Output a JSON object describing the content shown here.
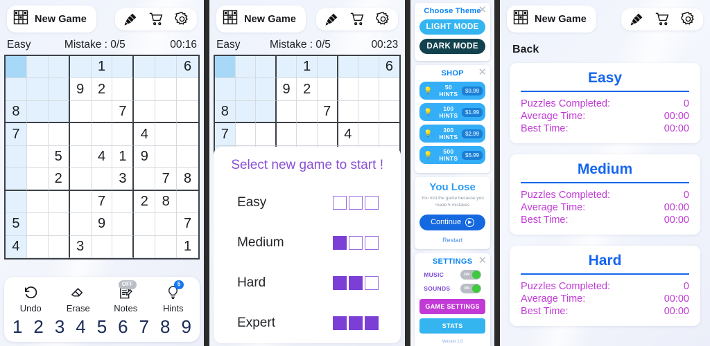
{
  "app": {
    "new_game_label": "New Game",
    "icons": {
      "grid": "grid-icon",
      "brush": "brush-icon",
      "cart": "cart-icon",
      "gear": "gear-icon"
    }
  },
  "panel1": {
    "status": {
      "difficulty": "Easy",
      "mistake": "Mistake : 0/5",
      "timer": "00:16"
    },
    "board": {
      "selected": [
        0,
        0
      ],
      "rows": [
        [
          "",
          "",
          "",
          "",
          "1",
          "",
          "",
          "",
          "6"
        ],
        [
          "",
          "",
          "",
          "9",
          "2",
          "",
          "",
          "",
          ""
        ],
        [
          "8",
          "",
          "",
          "",
          "",
          "7",
          "",
          "",
          ""
        ],
        [
          "7",
          "",
          "",
          "",
          "",
          "",
          "4",
          "",
          ""
        ],
        [
          "",
          "",
          "5",
          "",
          "4",
          "1",
          "9",
          "",
          ""
        ],
        [
          "",
          "",
          "2",
          "",
          "",
          "3",
          "",
          "7",
          "8"
        ],
        [
          "",
          "",
          "",
          "",
          "7",
          "",
          "2",
          "8",
          ""
        ],
        [
          "5",
          "",
          "",
          "",
          "9",
          "",
          "",
          "",
          "7"
        ],
        [
          "4",
          "",
          "",
          "3",
          "",
          "",
          "",
          "",
          "1"
        ]
      ]
    },
    "tools": [
      {
        "name": "undo",
        "label": "Undo",
        "badge": ""
      },
      {
        "name": "erase",
        "label": "Erase",
        "badge": ""
      },
      {
        "name": "notes",
        "label": "Notes",
        "badge": "OFF"
      },
      {
        "name": "hints",
        "label": "Hints",
        "badge": "5"
      }
    ],
    "numpad": [
      "1",
      "2",
      "3",
      "4",
      "5",
      "6",
      "7",
      "8",
      "9"
    ]
  },
  "panel2": {
    "status": {
      "difficulty": "Easy",
      "mistake": "Mistake : 0/5",
      "timer": "00:23"
    },
    "select_title": "Select new game to start !",
    "difficulties": [
      {
        "label": "Easy",
        "filled": 0
      },
      {
        "label": "Medium",
        "filled": 1
      },
      {
        "label": "Hard",
        "filled": 2
      },
      {
        "label": "Expert",
        "filled": 3
      }
    ]
  },
  "panel3": {
    "theme": {
      "title": "Choose Theme",
      "light_label": "LIGHT MODE",
      "dark_label": "DARK MODE",
      "close": "✕"
    },
    "shop": {
      "title": "SHOP",
      "close": "✕",
      "items": [
        {
          "name": "50 HINTS",
          "price": "$0.99"
        },
        {
          "name": "100 HINTS",
          "price": "$1.99"
        },
        {
          "name": "300 HINTS",
          "price": "$2.99"
        },
        {
          "name": "500 HINTS",
          "price": "$5.99"
        }
      ]
    },
    "lose": {
      "title": "You Lose",
      "message": "You lost the game because you made 5 mistakes",
      "continue_label": "Continue",
      "restart_label": "Restart"
    },
    "settings": {
      "title": "SETTINGS",
      "close": "✕",
      "rows": [
        {
          "label": "MUSIC",
          "state": "ON"
        },
        {
          "label": "SOUNDS",
          "state": "ON"
        }
      ],
      "game_settings_label": "GAME SETTINGS",
      "stats_label": "STATS",
      "version": "Version 1.0"
    }
  },
  "panel4": {
    "back_label": "Back",
    "cards": [
      {
        "title": "Easy",
        "lines": [
          {
            "label": "Puzzles Completed:",
            "value": "0"
          },
          {
            "label": "Average Time:",
            "value": "00:00"
          },
          {
            "label": "Best Time:",
            "value": "00:00"
          }
        ]
      },
      {
        "title": "Medium",
        "lines": [
          {
            "label": "Puzzles Completed:",
            "value": "0"
          },
          {
            "label": "Average Time:",
            "value": "00:00"
          },
          {
            "label": "Best Time:",
            "value": "00:00"
          }
        ]
      },
      {
        "title": "Hard",
        "lines": [
          {
            "label": "Puzzles Completed:",
            "value": "0"
          },
          {
            "label": "Average Time:",
            "value": "00:00"
          },
          {
            "label": "Best Time:",
            "value": "00:00"
          }
        ]
      }
    ]
  },
  "colors": {
    "accent_blue": "#1565f0",
    "accent_purple": "#7c3fd6",
    "stat_label": "#c13ad6",
    "cell_highlight": "#e2f1fd",
    "cell_selected": "#a8d8f7"
  }
}
